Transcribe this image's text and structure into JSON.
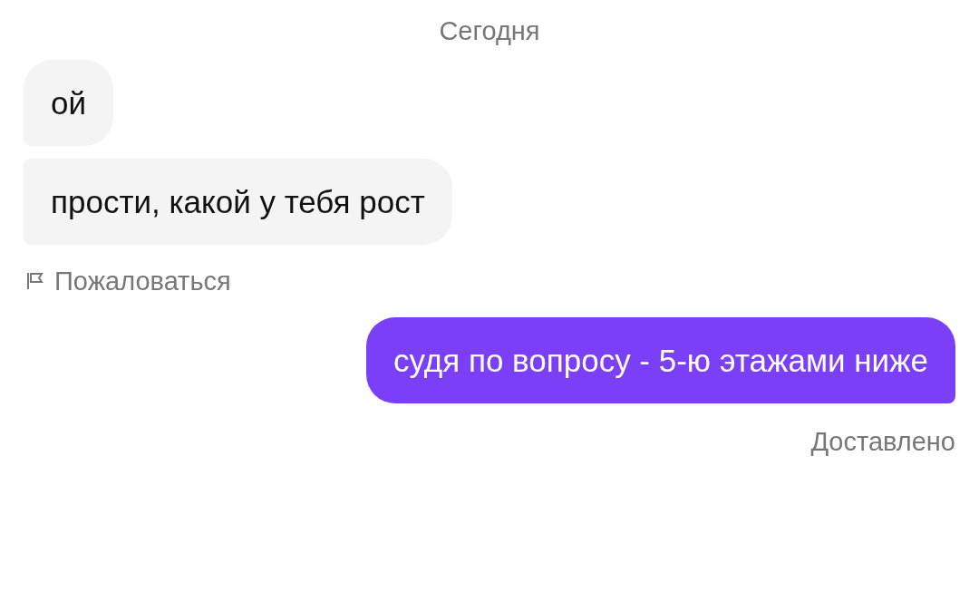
{
  "date_divider": "Сегодня",
  "items": [
    {
      "kind": "incoming",
      "text": "ой"
    },
    {
      "kind": "incoming",
      "text": "прости, какой у тебя рост"
    },
    {
      "kind": "report",
      "text": "Пожаловаться"
    },
    {
      "kind": "outgoing",
      "text": "судя по вопросу - 5-ю этажами ниже"
    },
    {
      "kind": "status",
      "text": "Доставлено"
    }
  ]
}
